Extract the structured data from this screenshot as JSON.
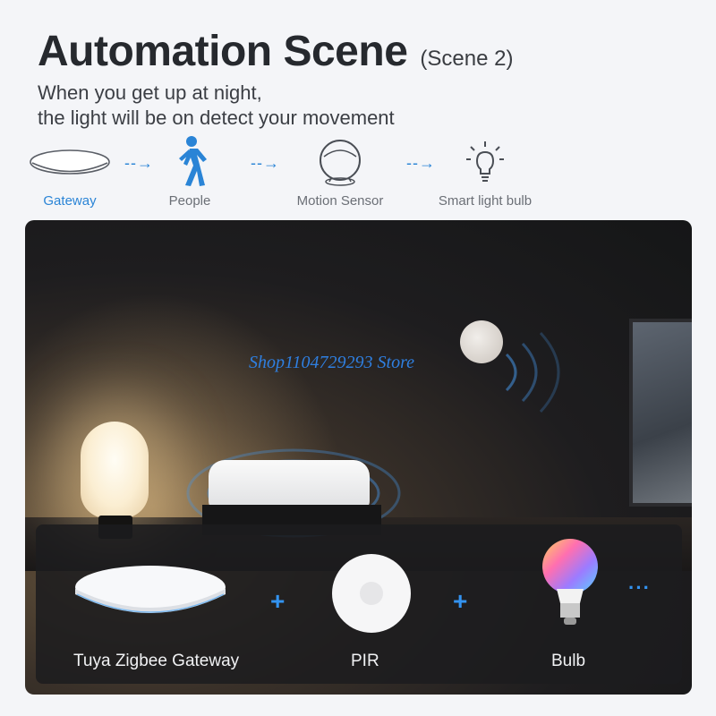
{
  "header": {
    "title": "Automation Scene",
    "title_suffix": "(Scene 2)",
    "subtitle_line1": "When you get up at night,",
    "subtitle_line2": "the light will be on detect your movement"
  },
  "flow": {
    "steps": [
      {
        "label": "Gateway",
        "icon": "gateway-icon"
      },
      {
        "label": "People",
        "icon": "walking-person-icon"
      },
      {
        "label": "Motion Sensor",
        "icon": "motion-sensor-icon"
      },
      {
        "label": "Smart light bulb",
        "icon": "light-bulb-icon"
      }
    ],
    "arrow": "→",
    "accent_color": "#2a84d6"
  },
  "photo": {
    "watermark": "Shop1104729293 Store"
  },
  "products": {
    "items": [
      {
        "label": "Tuya Zigbee Gateway",
        "icon": "gateway-device"
      },
      {
        "label": "PIR",
        "icon": "pir-sensor"
      },
      {
        "label": "Bulb",
        "icon": "rgb-bulb"
      }
    ],
    "plus": "+",
    "more": "···",
    "accent_color": "#3393f0"
  }
}
